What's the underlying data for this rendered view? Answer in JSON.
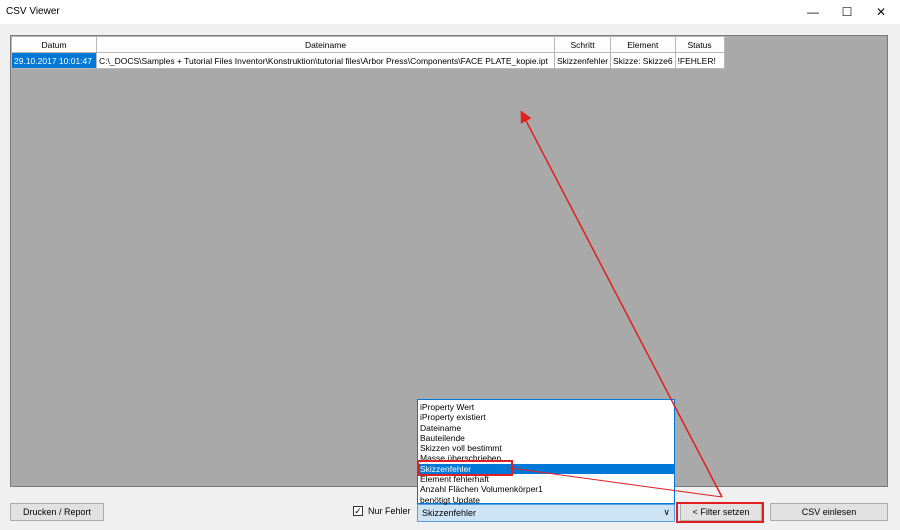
{
  "window": {
    "title": "CSV Viewer",
    "minimize_glyph": "—",
    "maximize_glyph": "☐",
    "close_glyph": "✕"
  },
  "table": {
    "columns": [
      "Datum",
      "Dateiname",
      "Schritt",
      "Element",
      "Status"
    ],
    "rows": [
      [
        "29.10.2017 10:01:47",
        "C:\\_DOCS\\Samples + Tutorial Files Inventor\\Konstruktion\\tutorial files\\Arbor Press\\Components\\FACE PLATE_kopie.ipt",
        "Skizzenfehler",
        "Skizze: Skizze6",
        "!FEHLER!"
      ]
    ]
  },
  "footer": {
    "print_label": "Drucken / Report",
    "filter_checkbox_label": "Nur Fehler",
    "filter_checked": true,
    "combo_value": "Skizzenfehler",
    "set_filter_label": "< Filter setzen",
    "read_csv_label": "CSV einlesen"
  },
  "dropdown": {
    "items": [
      "iProperty Wert",
      "iProperty existiert",
      "Dateiname",
      "Bauteilende",
      "Skizzen voll bestimmt",
      "Masse überschrieben",
      "Skizzenfehler",
      "Element fehlerhaft",
      "Anzahl Flächen Volumenkörper1",
      "benötigt Update"
    ],
    "selected_index": 6
  },
  "colors": {
    "selection": "#0078d7",
    "annotation": "#e02020",
    "grid_bg": "#a9a9a9"
  }
}
